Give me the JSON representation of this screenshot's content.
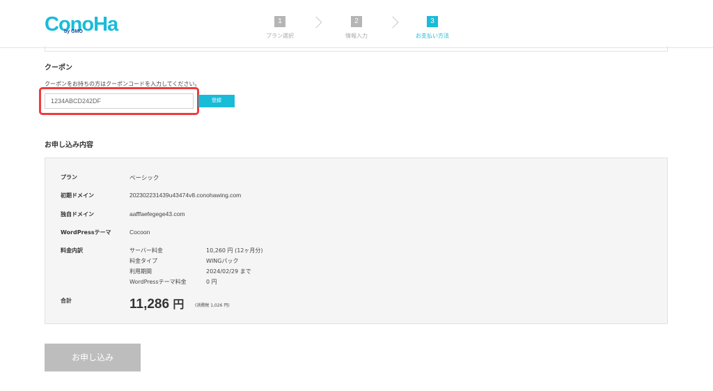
{
  "header": {
    "logo": "ConoHa",
    "logo_sub": "by GMO",
    "steps": [
      {
        "num": "1",
        "label": "プラン選択"
      },
      {
        "num": "2",
        "label": "情報入力"
      },
      {
        "num": "3",
        "label": "お支払い方法"
      }
    ],
    "active_step": 3
  },
  "coupon": {
    "title": "クーポン",
    "note": "クーポンをお持ちの方はクーポンコードを入力してください。",
    "input_value": "1234ABCD242DF",
    "register_label": "登録"
  },
  "summary": {
    "title": "お申し込み内容",
    "rows": [
      {
        "label": "プラン",
        "value": "ベーシック"
      },
      {
        "label": "初期ドメイン",
        "value": "202302231439u43474v8.conohawing.com"
      },
      {
        "label": "独自ドメイン",
        "value": "aafffaefegege43.com"
      },
      {
        "label": "WordPressテーマ",
        "value": "Cocoon"
      }
    ],
    "fee_label": "料金内訳",
    "fees": [
      {
        "name": "サーバー料金",
        "value": "10,260 円 (12ヶ月分)"
      },
      {
        "name": "料金タイプ",
        "value": "WINGパック"
      },
      {
        "name": "利用期間",
        "value": "2024/02/29 まで"
      },
      {
        "name": "WordPressテーマ料金",
        "value": "0 円"
      }
    ],
    "total_label": "合計",
    "total_amount": "11,286",
    "total_unit": "円",
    "total_tax": "(消費税 1,026 円)"
  },
  "submit_label": "お申し込み",
  "colors": {
    "accent": "#19bcd8",
    "highlight": "#ee3b3b",
    "disabled": "#bdbdbd"
  }
}
